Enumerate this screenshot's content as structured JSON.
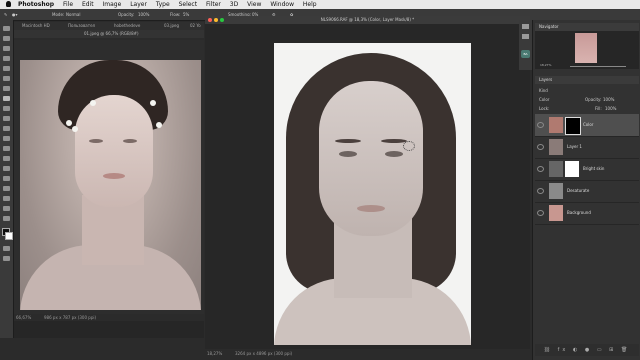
{
  "menubar": {
    "app": "Photoshop",
    "items": [
      "File",
      "Edit",
      "Image",
      "Layer",
      "Type",
      "Select",
      "Filter",
      "3D",
      "View",
      "Window",
      "Help"
    ]
  },
  "options": {
    "mode_label": "Mode:",
    "mode_value": "Normal",
    "opacity_label": "Opacity:",
    "opacity_value": "100%",
    "flow_label": "Flow:",
    "flow_value": "5%",
    "smoothing_label": "Smoothing:",
    "smoothing_value": "0%"
  },
  "tabs_top": [
    "Macintosh HD",
    "Пользовател",
    "hobethedeve",
    "03.jpeg",
    "02 Yo"
  ],
  "doc1_title": "01.jpeg @ 66,7% (RGB/8#)",
  "doc1_status_zoom": "66,67%",
  "doc1_status_info": "986 px x 787 px (300 ppi)",
  "doc2_title": "NLS9066.RAF @ 18,3% (Color, Layer Mask/8) *",
  "doc2_status_zoom": "18,27%",
  "doc2_status_info": "3264 px x 4896 px (300 ppi)",
  "navigator": {
    "title": "Navigator",
    "zoom": "18,27%"
  },
  "layers_panel": {
    "title": "Layers",
    "kind_label": "Kind",
    "blend_mode": "Color",
    "opacity_label": "Opacity:",
    "opacity_value": "100%",
    "lock_label": "Lock:",
    "fill_label": "Fill:",
    "fill_value": "100%",
    "layers": [
      {
        "name": "Color",
        "thumb": "#b07a70",
        "mask": "#000000",
        "selected": true
      },
      {
        "name": "Layer 1",
        "thumb": "#8a7b78",
        "mask": "",
        "selected": false
      },
      {
        "name": "Bright skin",
        "thumb": "#666666",
        "mask": "#ffffff",
        "selected": false
      },
      {
        "name": "Desaturate",
        "thumb": "#8a8a8a",
        "mask": "",
        "selected": false
      },
      {
        "name": "Background",
        "thumb": "#c89790",
        "mask": "",
        "selected": false
      }
    ],
    "footer_icons": "⛓ fx ◐ ● ▭ ⊞ 🗑"
  },
  "colors": {
    "accent": "#4a4a4a",
    "selected_row": "#4f4f4f"
  }
}
